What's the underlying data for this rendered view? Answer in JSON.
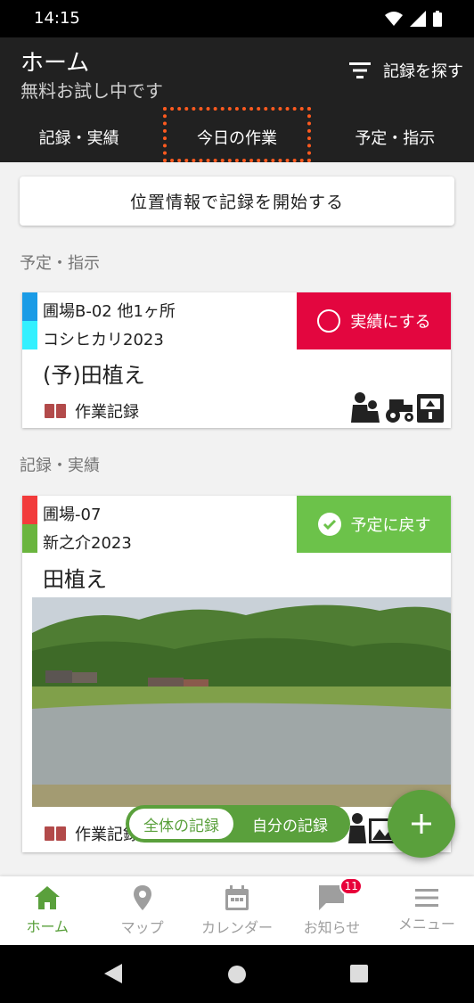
{
  "status_bar": {
    "time": "14:15"
  },
  "header": {
    "title": "ホーム",
    "subtitle": "無料お試し中です",
    "search_label": "記録を探す"
  },
  "tabs": [
    {
      "label": "記録・実績"
    },
    {
      "label": "今日の作業"
    },
    {
      "label": "予定・指示"
    }
  ],
  "location_button": {
    "label": "位置情報で記録を開始する"
  },
  "sections": {
    "planned": "予定・指示",
    "records": "記録・実績"
  },
  "planned_card": {
    "field": "圃場B-02 他1ヶ所",
    "crop": "コシヒカリ2023",
    "task": "(予)田植え",
    "action_label": "実績にする",
    "record_type": "作業記録",
    "colors": {
      "field": "#1a9be6",
      "crop": "#33f0ff",
      "action": "#e3063f"
    }
  },
  "record_card": {
    "field": "圃場-07",
    "crop": "新之介2023",
    "task": "田植え",
    "action_label": "予定に戻す",
    "record_type": "作業記録",
    "colors": {
      "field": "#f23b3b",
      "crop": "#6ab53e",
      "action": "#6cc24a"
    }
  },
  "toggle": {
    "all_label": "全体の記録",
    "mine_label": "自分の記録"
  },
  "bottom_nav": [
    {
      "label": "ホーム",
      "icon": "home-icon"
    },
    {
      "label": "マップ",
      "icon": "map-pin-icon"
    },
    {
      "label": "カレンダー",
      "icon": "calendar-icon"
    },
    {
      "label": "お知らせ",
      "icon": "message-icon",
      "badge": "11"
    },
    {
      "label": "メニュー",
      "icon": "menu-icon"
    }
  ],
  "accent_color": "#5aa03c"
}
